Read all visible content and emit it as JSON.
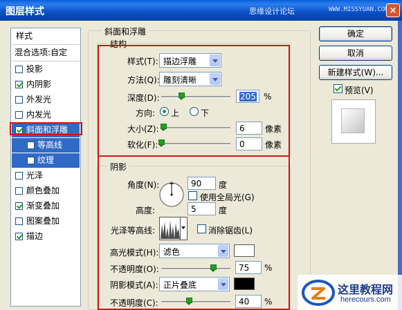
{
  "window": {
    "title": "图层样式",
    "watermark_text": "思缘设计论坛",
    "watermark_url": "WWW.MISSYUAN.COM",
    "close_label": "×"
  },
  "style_list": {
    "header": "样式",
    "blend_options": "混合选项:自定",
    "items": [
      {
        "label": "投影",
        "checked": false
      },
      {
        "label": "内阴影",
        "checked": true
      },
      {
        "label": "外发光",
        "checked": false
      },
      {
        "label": "内发光",
        "checked": false
      },
      {
        "label": "斜面和浮雕",
        "checked": true
      },
      {
        "label": "等高线",
        "checked": false
      },
      {
        "label": "纹理",
        "checked": false
      },
      {
        "label": "光泽",
        "checked": false
      },
      {
        "label": "颜色叠加",
        "checked": false
      },
      {
        "label": "渐变叠加",
        "checked": true
      },
      {
        "label": "图案叠加",
        "checked": false
      },
      {
        "label": "描边",
        "checked": true
      }
    ]
  },
  "bevel": {
    "section_title": "斜面和浮雕",
    "structure": {
      "title": "结构",
      "style_label": "样式(T):",
      "style_value": "描边浮雕",
      "technique_label": "方法(Q):",
      "technique_value": "雕刻清晰",
      "depth_label": "深度(D):",
      "depth_value": "205",
      "depth_unit": "%",
      "depth_fraction": 0.205,
      "direction_label": "方向:",
      "direction_up": "上",
      "direction_down": "下",
      "direction_selected": "上",
      "size_label": "大小(Z):",
      "size_value": "6",
      "size_unit": "像素",
      "size_fraction": 0.03,
      "soften_label": "软化(F):",
      "soften_value": "0",
      "soften_unit": "像素",
      "soften_fraction": 0.0
    },
    "shading": {
      "title": "阴影",
      "angle_label": "角度(N):",
      "angle_value": "90",
      "angle_unit": "度",
      "global_light_label": "使用全局光(G)",
      "global_light_checked": false,
      "altitude_label": "高度:",
      "altitude_value": "5",
      "altitude_unit": "度",
      "gloss_contour_label": "光泽等高线:",
      "anti_alias_label": "消除锯齿(L)",
      "anti_alias_checked": false,
      "highlight_mode_label": "高光模式(H):",
      "highlight_mode_value": "滤色",
      "highlight_color": "#ffffff",
      "highlight_opacity_label": "不透明度(O):",
      "highlight_opacity_value": "75",
      "highlight_opacity_unit": "%",
      "highlight_opacity_fraction": 0.75,
      "shadow_mode_label": "阴影模式(A):",
      "shadow_mode_value": "正片叠底",
      "shadow_color": "#000000",
      "shadow_opacity_label": "不透明度(C):",
      "shadow_opacity_value": "40",
      "shadow_opacity_unit": "%",
      "shadow_opacity_fraction": 0.4
    }
  },
  "buttons": {
    "ok": "确定",
    "cancel": "取消",
    "new_style": "新建样式(W)...",
    "preview_label": "预览(V)",
    "preview_checked": true
  },
  "logo": {
    "name": "这里教程网",
    "url": "herecours.com"
  },
  "colors": {
    "selection": "#316ac5",
    "highlight_box": "#d21414",
    "check": "#21a121"
  }
}
